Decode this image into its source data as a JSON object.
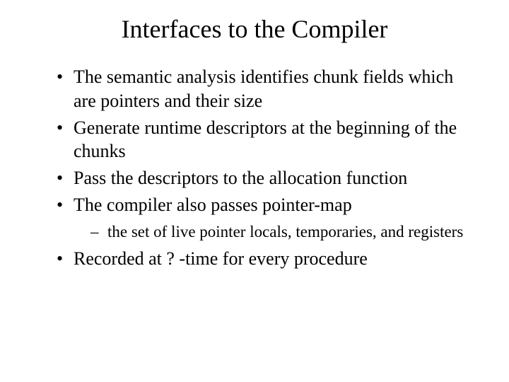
{
  "title": "Interfaces to the Compiler",
  "bullets": {
    "b0": "The semantic analysis identifies chunk fields which are pointers and their size",
    "b1": "Generate runtime descriptors at the beginning of the chunks",
    "b2": "Pass the descriptors to the allocation function",
    "b3": "The compiler also passes pointer-map",
    "b3_sub0": "the set of live pointer locals, temporaries, and registers",
    "b4": "Recorded at ? -time for every procedure"
  }
}
